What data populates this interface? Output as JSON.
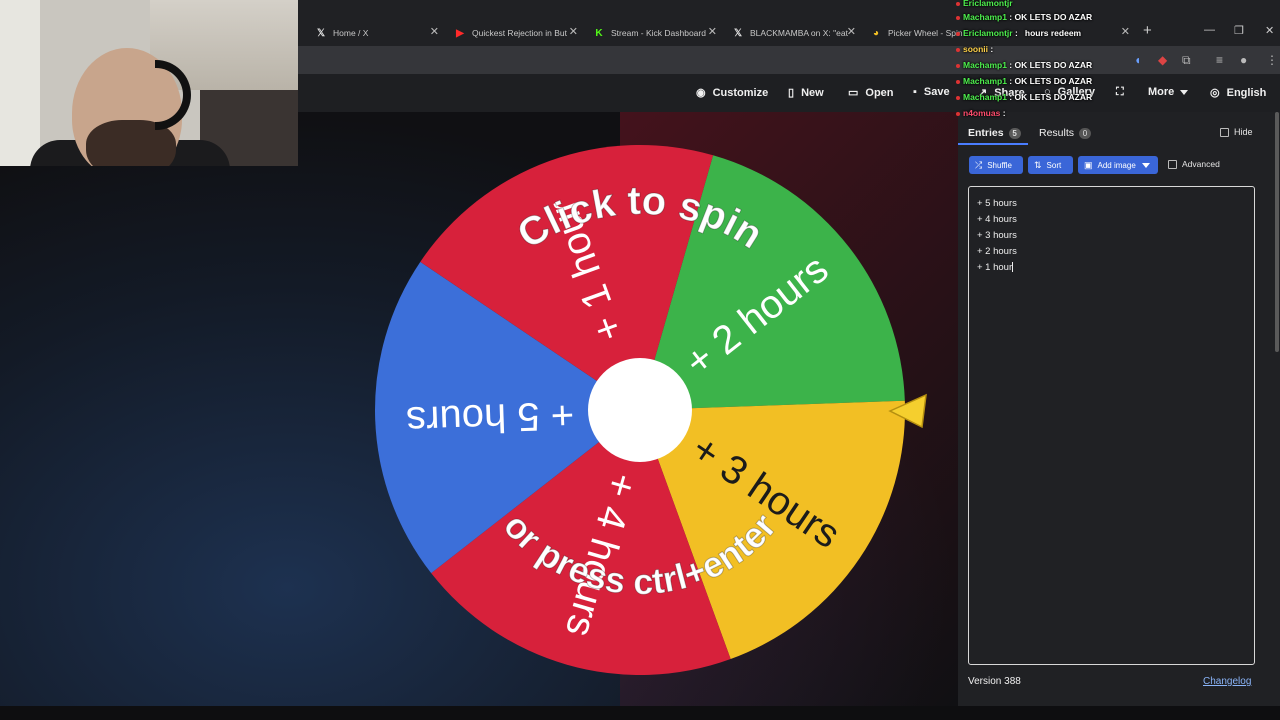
{
  "browser": {
    "tabs": [
      {
        "title": "Home / X",
        "icon": "x-logo-icon"
      },
      {
        "title": "Quickest Rejection in But",
        "icon": "youtube-icon"
      },
      {
        "title": "Stream - Kick Dashboard",
        "icon": "kick-icon"
      },
      {
        "title": "BLACKMAMBA on X: \"eat",
        "icon": "x-logo-icon"
      },
      {
        "title": "Picker Wheel - Spin",
        "icon": "picker-wheel-icon"
      }
    ]
  },
  "nav": {
    "customize": "Customize",
    "new": "New",
    "open": "Open",
    "save": "Save",
    "share": "Share",
    "gallery": "Gallery",
    "more": "More",
    "language": "English"
  },
  "wheel": {
    "caption_top": "Click to spin",
    "caption_bottom": "or press ctrl+enter",
    "segments": [
      {
        "label": "+ 2 hours",
        "color": "#3cb34a"
      },
      {
        "label": "+ 3 hours",
        "color": "#f2bf24"
      },
      {
        "label": "+ 4 hours",
        "color": "#d7213b"
      },
      {
        "label": "+ 5 hours",
        "color": "#3c6fd9"
      },
      {
        "label": "+ 1 hour",
        "color": "#d7213b"
      }
    ],
    "center_color": "#ffffff",
    "pointer_color": "#f5cf2e"
  },
  "panel": {
    "tab_entries": "Entries",
    "entries_count": "5",
    "tab_results": "Results",
    "results_count": "0",
    "hide_label": "Hide",
    "shuffle_label": "Shuffle",
    "sort_label": "Sort",
    "add_image_label": "Add image",
    "advanced_label": "Advanced",
    "entries": [
      "+ 5 hours",
      "+ 4 hours",
      "+ 3 hours",
      "+ 2 hours",
      "+ 1 hour"
    ],
    "version": "Version 388",
    "changelog": "Changelog",
    "accent": "#3a66d8"
  },
  "chat": {
    "lines": [
      {
        "user": "Ericlamontjr",
        "message": "",
        "color": "green"
      },
      {
        "user": "Machamp1",
        "message": " : OK LETS DO AZAR",
        "color": "green"
      },
      {
        "user": "Ericlamontjr",
        "message": " : ⁠ ⁠ hours redeem",
        "color": "green"
      },
      {
        "user": "soonii",
        "message": " :",
        "color": "yellow"
      },
      {
        "user": "Machamp1",
        "message": " : OK LETS DO AZAR",
        "color": "green"
      },
      {
        "user": "Machamp1",
        "message": " : OK LETS DO AZAR",
        "color": "green"
      },
      {
        "user": "Machamp1",
        "message": " : OK LETS DO AZAR",
        "color": "green"
      },
      {
        "user": "n4omuas",
        "message": " :",
        "color": "red"
      }
    ]
  }
}
